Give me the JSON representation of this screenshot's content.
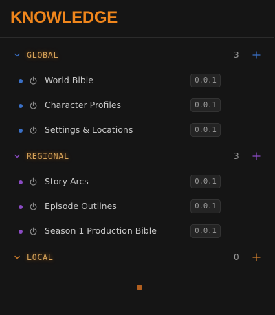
{
  "panel": {
    "title": "KNOWLEDGE"
  },
  "colors": {
    "title": "#f0861c",
    "global": "#3a70c7",
    "regional": "#8b4bc4",
    "local": "#d27f2c",
    "section_label_global": "#d7a45a",
    "section_label_regional": "#d7a45a",
    "section_label_local": "#d7a45a"
  },
  "sections": [
    {
      "label": "GLOBAL",
      "count": "3",
      "icon": "chevron-down-icon",
      "items": [
        {
          "label": "World Bible",
          "version": "0.0.1"
        },
        {
          "label": "Character Profiles",
          "version": "0.0.1"
        },
        {
          "label": "Settings & Locations",
          "version": "0.0.1"
        }
      ]
    },
    {
      "label": "REGIONAL",
      "count": "3",
      "icon": "chevron-down-icon",
      "items": [
        {
          "label": "Story Arcs",
          "version": "0.0.1"
        },
        {
          "label": "Episode Outlines",
          "version": "0.0.1"
        },
        {
          "label": "Season 1 Production Bible",
          "version": "0.0.1"
        }
      ]
    },
    {
      "label": "LOCAL",
      "count": "0",
      "icon": "chevron-down-icon",
      "items": []
    }
  ]
}
